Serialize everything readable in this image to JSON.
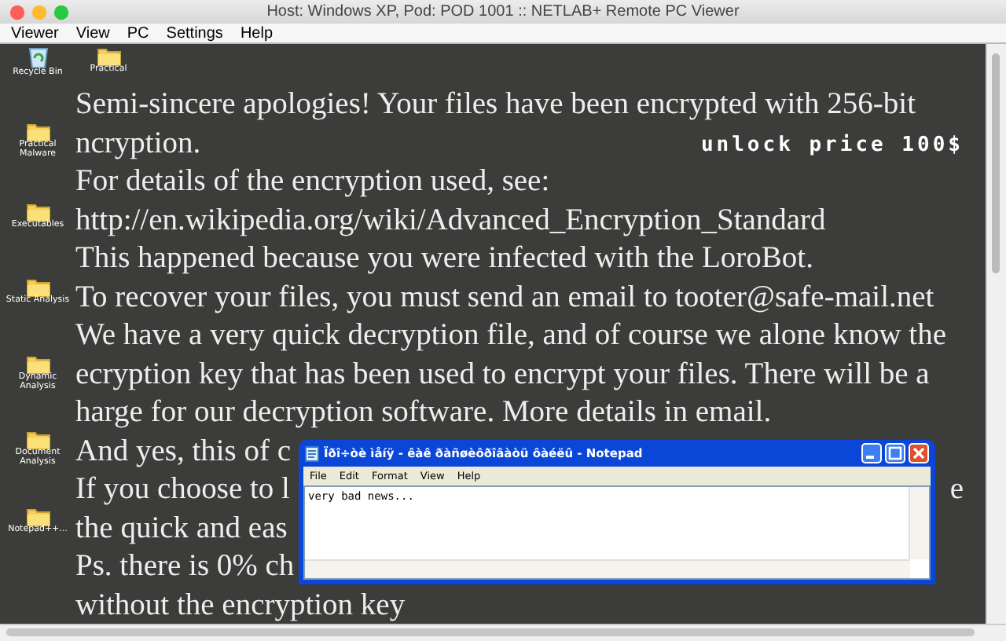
{
  "window": {
    "title": "Host: Windows XP, Pod: POD 1001 :: NETLAB+ Remote PC Viewer"
  },
  "menu": [
    "Viewer",
    "View",
    "PC",
    "Settings",
    "Help"
  ],
  "desktop": {
    "note_lines": [
      {
        "text": "Semi-sincere apologies! Your files have been encrypted with 256-bit"
      },
      {
        "text": "ncryption."
      },
      {
        "text": "For details of the encryption used, see:"
      },
      {
        "text": "http://en.wikipedia.org/wiki/Advanced_Encryption_Standard"
      },
      {
        "text": "This happened because you were infected with the LoroBot."
      },
      {
        "text": "To recover your files, you must send an email to tooter@safe-mail.net"
      },
      {
        "text": "We have a very quick decryption file, and of course we alone know the"
      },
      {
        "text": "ecryption key that has been used to encrypt your files. There will be a"
      },
      {
        "text": "harge for our decryption software. More details in email."
      },
      {
        "text": "And yes, this of c"
      },
      {
        "text": "If you choose to l",
        "tail": "e"
      },
      {
        "text": "the quick and eas"
      },
      {
        "text": "Ps. there is 0% ch"
      },
      {
        "text": "without the encryption key"
      }
    ],
    "price_banner": "unlock price 100$",
    "icons": [
      {
        "kind": "recycle",
        "label": "Recycle Bin"
      },
      {
        "kind": "folder",
        "label": "Practical"
      },
      {
        "kind": "folder",
        "label": "Practical Malware"
      },
      {
        "kind": "folder",
        "label": "Executables"
      },
      {
        "kind": "folder",
        "label": "Static Analysis"
      },
      {
        "kind": "folder",
        "label": "Dynamic Analysis"
      },
      {
        "kind": "folder",
        "label": "Document Analysis"
      },
      {
        "kind": "folder",
        "label": "Notepad++..."
      }
    ]
  },
  "notepad": {
    "title": "Ïðî÷òè ìåíÿ - êàê ðàñøèôðîâàòü ôàéëû - Notepad",
    "menu": [
      "File",
      "Edit",
      "Format",
      "View",
      "Help"
    ],
    "content": "very bad news..."
  }
}
